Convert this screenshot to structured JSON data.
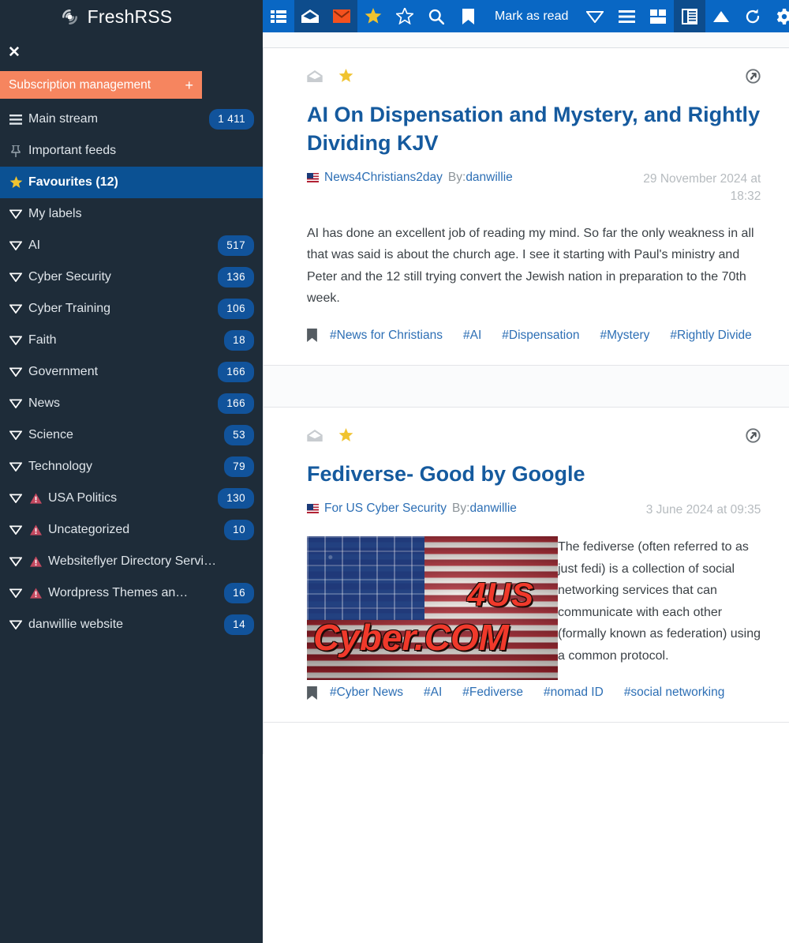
{
  "app": {
    "brand": "FreshRSS",
    "brand_logo_icon": "rss-signal-icon"
  },
  "sidebar": {
    "close_label": "✕",
    "subscription": {
      "label": "Subscription management",
      "add_label": "+"
    },
    "items": [
      {
        "icon": "hamburger-icon",
        "label": "Main stream",
        "count": "1 411",
        "active": false,
        "warn": false
      },
      {
        "icon": "pin-icon",
        "label": "Important feeds",
        "count": "",
        "active": false,
        "warn": false
      },
      {
        "icon": "star-icon",
        "label": "Favourites (12)",
        "count": "",
        "active": true,
        "warn": false
      },
      {
        "icon": "triangle-down-icon",
        "label": "My labels",
        "count": "",
        "active": false,
        "warn": false
      },
      {
        "icon": "triangle-down-icon",
        "label": "AI",
        "count": "517",
        "active": false,
        "warn": false
      },
      {
        "icon": "triangle-down-icon",
        "label": "Cyber Security",
        "count": "136",
        "active": false,
        "warn": false
      },
      {
        "icon": "triangle-down-icon",
        "label": "Cyber Training",
        "count": "106",
        "active": false,
        "warn": false
      },
      {
        "icon": "triangle-down-icon",
        "label": "Faith",
        "count": "18",
        "active": false,
        "warn": false
      },
      {
        "icon": "triangle-down-icon",
        "label": "Government",
        "count": "166",
        "active": false,
        "warn": false
      },
      {
        "icon": "triangle-down-icon",
        "label": "News",
        "count": "166",
        "active": false,
        "warn": false
      },
      {
        "icon": "triangle-down-icon",
        "label": "Science",
        "count": "53",
        "active": false,
        "warn": false
      },
      {
        "icon": "triangle-down-icon",
        "label": "Technology",
        "count": "79",
        "active": false,
        "warn": false
      },
      {
        "icon": "triangle-down-icon",
        "label": "USA Politics",
        "count": "130",
        "active": false,
        "warn": true
      },
      {
        "icon": "triangle-down-icon",
        "label": "Uncategorized",
        "count": "10",
        "active": false,
        "warn": true
      },
      {
        "icon": "triangle-down-icon",
        "label": "Websiteflyer Directory Servi…",
        "count": "",
        "active": false,
        "warn": true
      },
      {
        "icon": "triangle-down-icon",
        "label": "Wordpress Themes an…",
        "count": "16",
        "active": false,
        "warn": true
      },
      {
        "icon": "triangle-down-icon",
        "label": "danwillie website",
        "count": "14",
        "active": false,
        "warn": false
      }
    ]
  },
  "toolbar": {
    "left_buttons": [
      {
        "icon": "list-view-icon",
        "active": false
      },
      {
        "icon": "envelope-open-icon",
        "active": true
      },
      {
        "icon": "envelope-unread-icon",
        "active": true
      },
      {
        "icon": "star-filled-icon",
        "active": false
      },
      {
        "icon": "star-outline-icon",
        "active": false
      },
      {
        "icon": "search-icon",
        "active": false
      },
      {
        "icon": "bookmark-icon",
        "active": false
      }
    ],
    "mark_as_read_label": "Mark as read",
    "right_buttons": [
      {
        "icon": "triangle-down-icon",
        "active": false
      },
      {
        "icon": "hamburger-icon",
        "active": false
      },
      {
        "icon": "grid-view-icon",
        "active": false
      },
      {
        "icon": "reading-view-icon",
        "active": true
      },
      {
        "icon": "triangle-up-icon",
        "active": false
      },
      {
        "icon": "refresh-icon",
        "active": false
      },
      {
        "icon": "gear-icon",
        "active": false
      }
    ]
  },
  "articles": [
    {
      "read_icon": "envelope-open-icon",
      "star_icon": "star-filled-icon",
      "share_icon": "share-circle-icon",
      "title": "AI On Dispensation and Mystery, and Rightly Dividing KJV",
      "feed": "News4Christians2day",
      "by_prefix": "By:",
      "author": "danwillie",
      "date": "29 November 2024 at 18:32",
      "body": "AI has done an excellent job of reading my mind. So far the only weakness in all that was said is about the church age. I see it starting with Paul's ministry and Peter and the 12 still trying convert the Jewish nation in preparation to the 70th week.",
      "has_image": false,
      "tags": [
        "#News for Christians",
        "#AI",
        "#Dispensation",
        "#Mystery",
        "#Rightly Divide"
      ]
    },
    {
      "read_icon": "envelope-open-icon",
      "star_icon": "star-filled-icon",
      "share_icon": "share-circle-icon",
      "title": "Fediverse- Good by Google",
      "feed": "For US Cyber Security",
      "by_prefix": "By:",
      "author": "danwillie",
      "date": "3 June 2024 at 09:35",
      "body": "The fediverse (often referred to as just fedi) is a collection of social networking services that can communicate with each other (formally known as federation) using a common protocol.",
      "has_image": true,
      "image": {
        "alt": "us-flag-4us-cyber-com-banner",
        "text_top": "4US",
        "text_bottom": "Cyber.COM"
      },
      "tags": [
        "#Cyber News",
        "#AI",
        "#Fediverse",
        "#nomad ID",
        "#social networking"
      ]
    }
  ],
  "colors": {
    "sidebar_bg": "#1e2c39",
    "accent_orange": "#f6855f",
    "toolbar_blue": "#0967c4",
    "toolbar_active": "#0d4c8c",
    "badge_blue": "#11539b",
    "link_blue": "#2d6fb5",
    "title_blue": "#155a9e",
    "star_gold": "#f0c330",
    "warn_red": "#c3485f"
  }
}
